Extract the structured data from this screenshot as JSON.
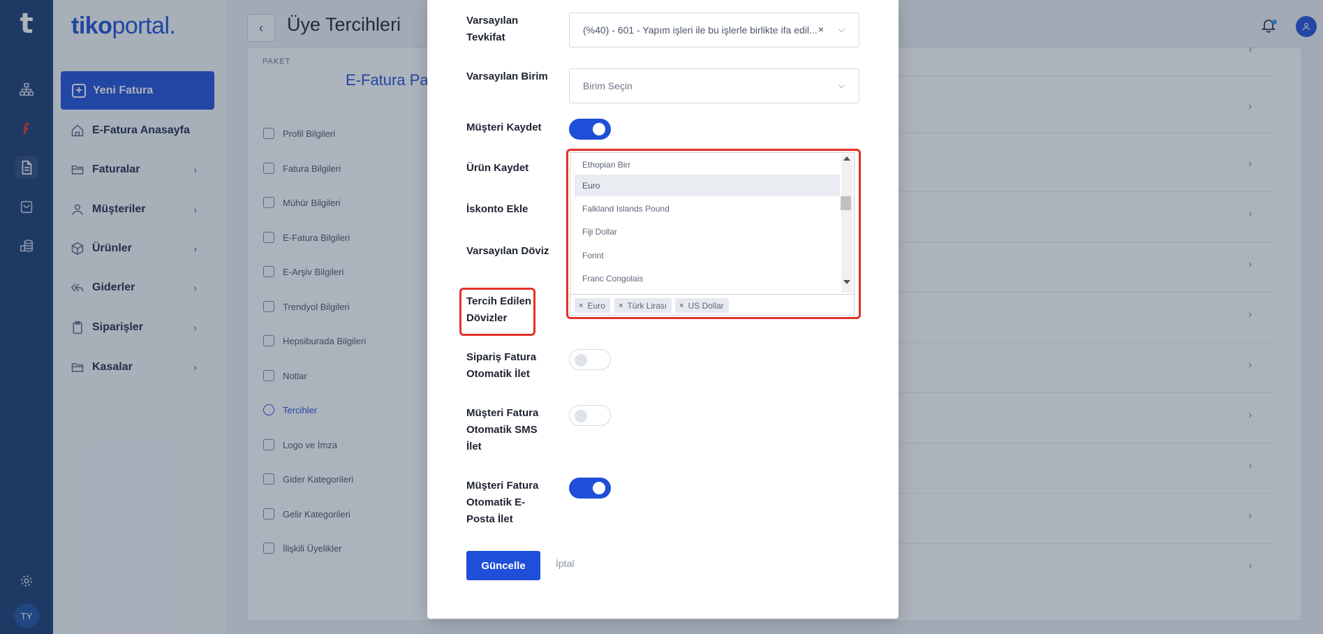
{
  "app": {
    "rail_logo": "t",
    "avatar_initials": "TY",
    "brand_bold": "tiko",
    "brand_light": "portal",
    "brand_dot": "."
  },
  "sidebar": {
    "new_invoice": "Yeni Fatura",
    "items": [
      {
        "label": "E-Fatura Anasayfa",
        "icon": "home-icon",
        "has_chevron": false
      },
      {
        "label": "Faturalar",
        "icon": "folder-icon",
        "has_chevron": true
      },
      {
        "label": "Müşteriler",
        "icon": "user-icon",
        "has_chevron": true
      },
      {
        "label": "Ürünler",
        "icon": "box-icon",
        "has_chevron": true
      },
      {
        "label": "Giderler",
        "icon": "reply-all-icon",
        "has_chevron": true
      },
      {
        "label": "Siparişler",
        "icon": "clipboard-icon",
        "has_chevron": true
      },
      {
        "label": "Kasalar",
        "icon": "folder-icon",
        "has_chevron": true
      }
    ]
  },
  "header": {
    "title": "Üye Tercihleri"
  },
  "card": {
    "paket_label": "PAKET",
    "paket_name": "E-Fatura Pa",
    "menu": [
      {
        "label": "Profil Bilgileri",
        "active": false
      },
      {
        "label": "Fatura Bilgileri",
        "active": false
      },
      {
        "label": "Mühür Bilgileri",
        "active": false
      },
      {
        "label": "E-Fatura Bilgileri",
        "active": false
      },
      {
        "label": "E-Arşiv Bilgileri",
        "active": false
      },
      {
        "label": "Trendyol Bilgileri",
        "active": false
      },
      {
        "label": "Hepsiburada Bilgileri",
        "active": false
      },
      {
        "label": "Notlar",
        "active": false
      },
      {
        "label": "Tercihler",
        "active": true
      },
      {
        "label": "Logo ve İmza",
        "active": false
      },
      {
        "label": "Gider Kategorileri",
        "active": false
      },
      {
        "label": "Gelir Kategorileri",
        "active": false
      },
      {
        "label": "İlişkili Üyelikler",
        "active": false
      }
    ]
  },
  "modal": {
    "fields": {
      "tevkifat_label": "Varsayılan Tevkifat",
      "tevkifat_value": "(%40) - 601 - Yapım işleri ile bu işlerle birlikte ifa edil...",
      "birim_label": "Varsayılan Birim",
      "birim_placeholder": "Birim Seçin",
      "musteri_kaydet_label": "Müşteri Kaydet",
      "musteri_kaydet_on": true,
      "urun_kaydet_label": "Ürün Kaydet",
      "iskonto_label": "İskonto Ekle",
      "doviz_label": "Varsayılan Döviz",
      "tercih_label": "Tercih Edilen Dövizler",
      "siparis_label": "Sipariş Fatura Otomatik İlet",
      "siparis_on": false,
      "sms_label": "Müşteri Fatura Otomatik SMS İlet",
      "sms_on": false,
      "eposta_label": "Müşteri Fatura Otomatik E-Posta İlet",
      "eposta_on": true
    },
    "currency_options": [
      "Ethopian Birr",
      "Euro",
      "Falkland Islands Pound",
      "Fiji Dollar",
      "Forint",
      "Franc Congolais"
    ],
    "highlighted_option": "Euro",
    "selected_tags": [
      "Euro",
      "Türk Lirası",
      "US Dollar"
    ],
    "update_button": "Güncelle",
    "cancel_link": "İptal"
  },
  "colors": {
    "accent": "#1f4fd8",
    "rail": "#1b3a73",
    "highlight_border": "#e2312a"
  }
}
